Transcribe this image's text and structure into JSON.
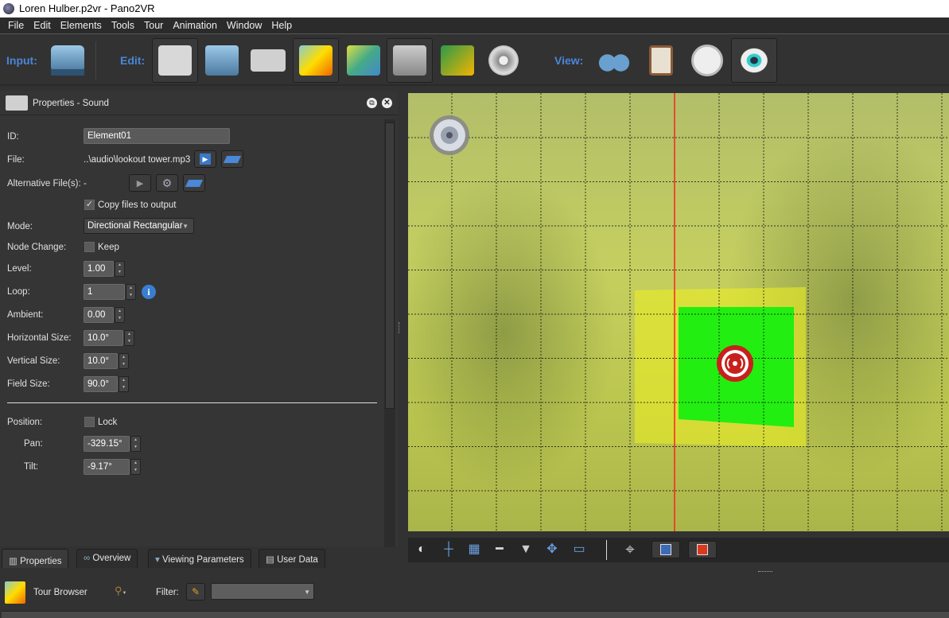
{
  "window": {
    "title": "Loren Hulber.p2vr - Pano2VR"
  },
  "menu": [
    "File",
    "Edit",
    "Elements",
    "Tools",
    "Tour",
    "Animation",
    "Window",
    "Help"
  ],
  "toolbar": {
    "input_label": "Input:",
    "edit_label": "Edit:",
    "view_label": "View:",
    "input_buttons": [
      "add-panorama"
    ],
    "edit_buttons": [
      "properties-sound",
      "viewing-parameters",
      "user-data",
      "tour-browser",
      "tour-map",
      "patch-input",
      "google-street-view",
      "animation"
    ],
    "view_buttons": [
      "overview",
      "properties",
      "viewing-parameters-view",
      "preview"
    ]
  },
  "panel": {
    "title": "Properties - Sound",
    "id_label": "ID:",
    "id_value": "Element01",
    "file_label": "File:",
    "file_value": "..\\audio\\lookout tower.mp3",
    "alt_label": "Alternative File(s):",
    "alt_value": "-",
    "copy_label": "Copy files to output",
    "copy_checked": true,
    "mode_label": "Mode:",
    "mode_value": "Directional Rectangular",
    "node_change_label": "Node Change:",
    "keep_label": "Keep",
    "keep_checked": false,
    "level_label": "Level:",
    "level_value": "1.00",
    "loop_label": "Loop:",
    "loop_value": "1",
    "ambient_label": "Ambient:",
    "ambient_value": "0.00",
    "hsize_label": "Horizontal Size:",
    "hsize_value": "10.0°",
    "vsize_label": "Vertical Size:",
    "vsize_value": "10.0°",
    "field_label": "Field Size:",
    "field_value": "90.0°",
    "position_label": "Position:",
    "lock_label": "Lock",
    "lock_checked": false,
    "pan_label": "Pan:",
    "pan_value": "-329.15°",
    "tilt_label": "Tilt:",
    "tilt_value": "-9.17°"
  },
  "tabs": [
    "Properties",
    "Overview",
    "Viewing Parameters",
    "User Data"
  ],
  "tour_browser": {
    "title": "Tour Browser",
    "filter_label": "Filter:",
    "filter_value": ""
  },
  "colors": {
    "accent": "#4a86d8",
    "sound_area": "#22ee11",
    "red_line": "#ff2020"
  }
}
